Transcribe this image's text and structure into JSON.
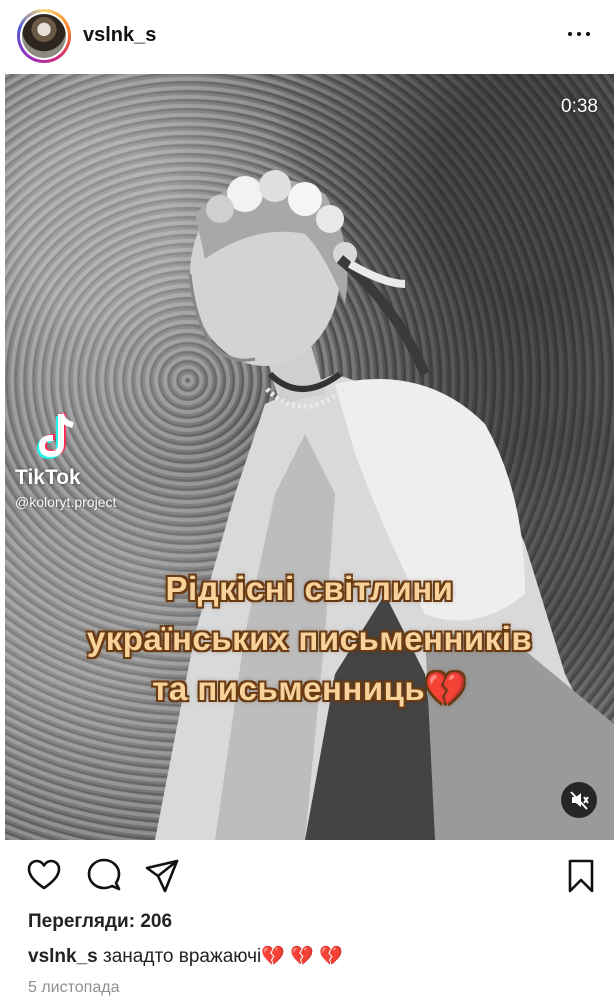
{
  "header": {
    "username": "vslnk_s"
  },
  "video": {
    "timer": "0:38",
    "watermark_name": "TikTok",
    "watermark_handle": "@koloryt.project",
    "caption_lines": [
      "Рідкісні світлини",
      "українських письменників",
      "та письменниць💔"
    ]
  },
  "views": "Перегляди: 206",
  "post_caption": {
    "user": "vslnk_s",
    "text": " занадто вражаючі💔 💔 💔"
  },
  "date": "5 листопада",
  "icons": [
    "more-options-icon",
    "tiktok-logo-icon",
    "muted-speaker-icon",
    "heart-icon",
    "comment-icon",
    "share-icon",
    "bookmark-icon"
  ]
}
